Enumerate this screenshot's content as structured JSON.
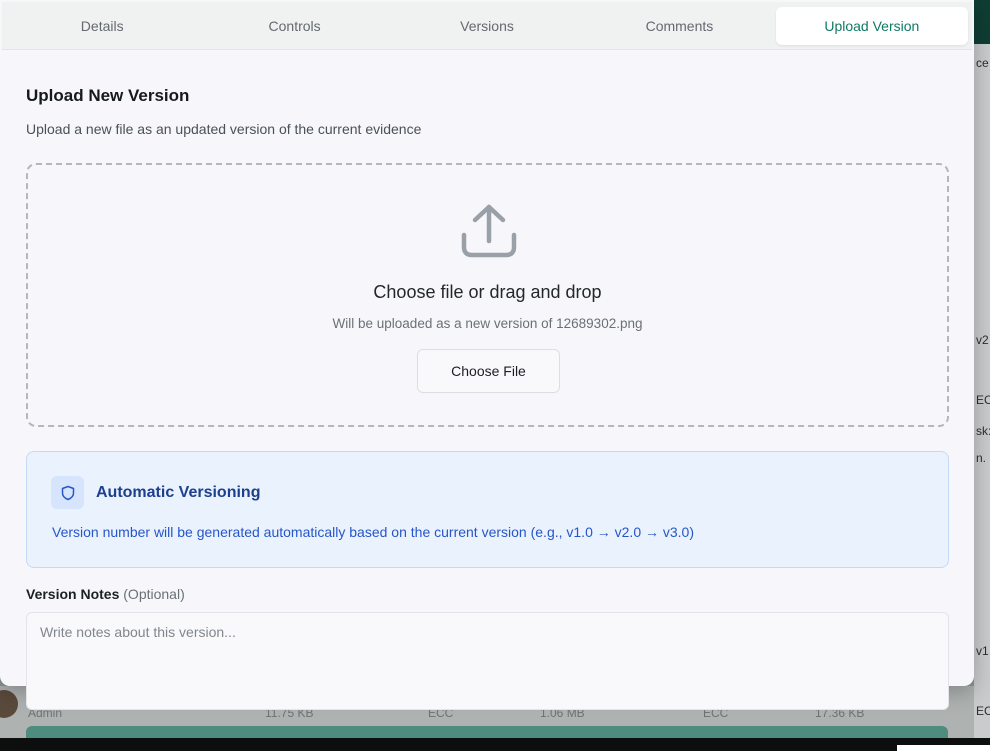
{
  "tabs": [
    {
      "label": "Details"
    },
    {
      "label": "Controls"
    },
    {
      "label": "Versions"
    },
    {
      "label": "Comments"
    },
    {
      "label": "Upload Version",
      "active": true
    }
  ],
  "upload": {
    "title": "Upload New Version",
    "subtitle": "Upload a new file as an updated version of the current evidence",
    "dropzone_title": "Choose file or drag and drop",
    "dropzone_subtitle": "Will be uploaded as a new version of 12689302.png",
    "choose_button": "Choose File",
    "icon": "upload-icon"
  },
  "versioning": {
    "icon": "shield-icon",
    "title": "Automatic Versioning",
    "description": "Version number will be generated automatically based on the current version (e.g., v1.0 → v2.0 → v3.0)"
  },
  "notes": {
    "label": "Version Notes",
    "optional": "(Optional)",
    "placeholder": "Write notes about this version...",
    "value": ""
  },
  "background": {
    "right_fragments": [
      "ce",
      "v2",
      "EC",
      "sk:",
      "n.",
      "v1",
      "EC"
    ],
    "bottom_row": [
      "Admin",
      "11.75 KB",
      "ECC",
      "1.06 MB",
      "ECC",
      "17.36 KB"
    ]
  },
  "colors": {
    "accent": "#0f7a63",
    "info_bg": "#eaf2fe",
    "info_text": "#2656c8",
    "info_title": "#1e3f8f"
  }
}
